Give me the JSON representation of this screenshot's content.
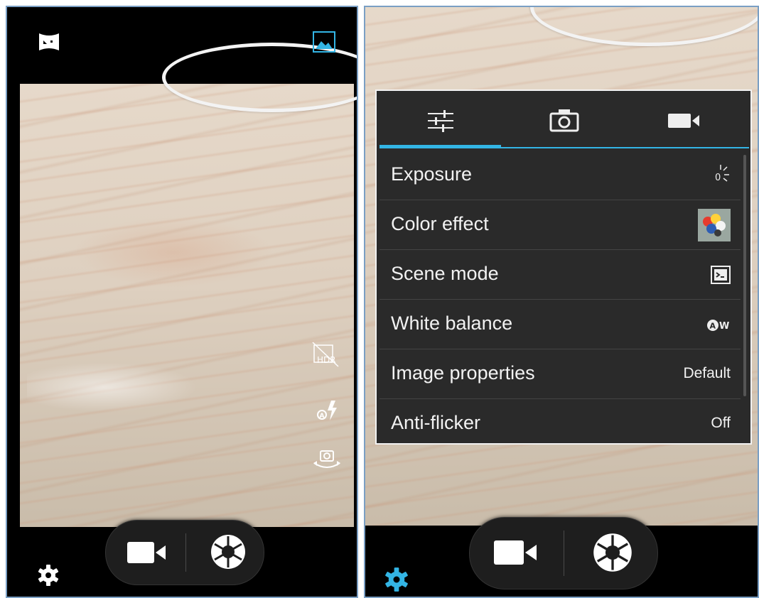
{
  "colors": {
    "accent": "#33b5e5",
    "panel_bg": "#000000",
    "menu_bg": "#2a2a2a",
    "text": "#f2f2f2"
  },
  "left_screen": {
    "top_icons": [
      "panorama-icon",
      "gallery-icon"
    ],
    "side_icons": [
      "hdr-off-icon",
      "flash-auto-icon",
      "switch-camera-icon"
    ],
    "bottom": {
      "settings_icon": "settings-gear-icon",
      "video_icon": "video-camera-icon",
      "shutter_icon": "shutter-icon"
    }
  },
  "right_screen": {
    "settings_menu": {
      "tabs": [
        {
          "icon": "sliders-icon",
          "active": true
        },
        {
          "icon": "camera-icon",
          "active": false
        },
        {
          "icon": "video-camera-icon",
          "active": false
        }
      ],
      "items": [
        {
          "label": "Exposure",
          "value_icon": "exposure-icon"
        },
        {
          "label": "Color effect",
          "value_icon": "color-effect-thumbnail"
        },
        {
          "label": "Scene mode",
          "value_icon": "scene-mode-icon"
        },
        {
          "label": "White balance",
          "value_icon": "auto-white-balance-icon"
        },
        {
          "label": "Image properties",
          "value": "Default"
        },
        {
          "label": "Anti-flicker",
          "value": "Off"
        }
      ]
    },
    "bottom": {
      "settings_icon": "settings-gear-icon",
      "settings_active": true,
      "video_icon": "video-camera-icon",
      "shutter_icon": "shutter-icon"
    }
  }
}
